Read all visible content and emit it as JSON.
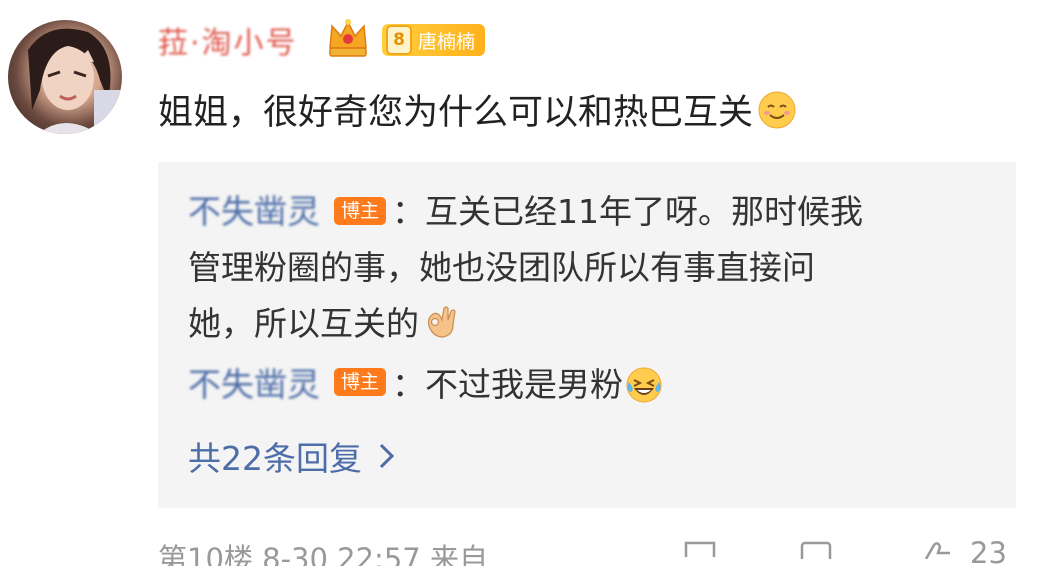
{
  "comment": {
    "username": "菈·淘小号",
    "fan_badge": {
      "level": "8",
      "name": "唐楠楠"
    },
    "text": "姐姐，很好奇您为什么可以和热巴互关",
    "emoji": "smile-emoji"
  },
  "replies": [
    {
      "author": "不失凿灵",
      "tag": "博主",
      "line1": "：互关已经11年了呀。那时候我",
      "line2": "管理粉圈的事，她也没团队所以有事直接问",
      "line3": "她，所以互关的",
      "emoji": "ok-hand-emoji"
    },
    {
      "author": "不失凿灵",
      "tag": "博主",
      "text": "：不过我是男粉",
      "emoji": "laugh-cry-emoji"
    }
  ],
  "more_replies": "共22条回复",
  "footer": {
    "meta": "第10楼  8-30 22:57  来自",
    "like_count": "23"
  },
  "colors": {
    "link_blue": "#4d6da8",
    "blogger_orange": "#ff7a1a",
    "reply_bg": "#f4f4f4",
    "username_red": "#e0574b"
  }
}
